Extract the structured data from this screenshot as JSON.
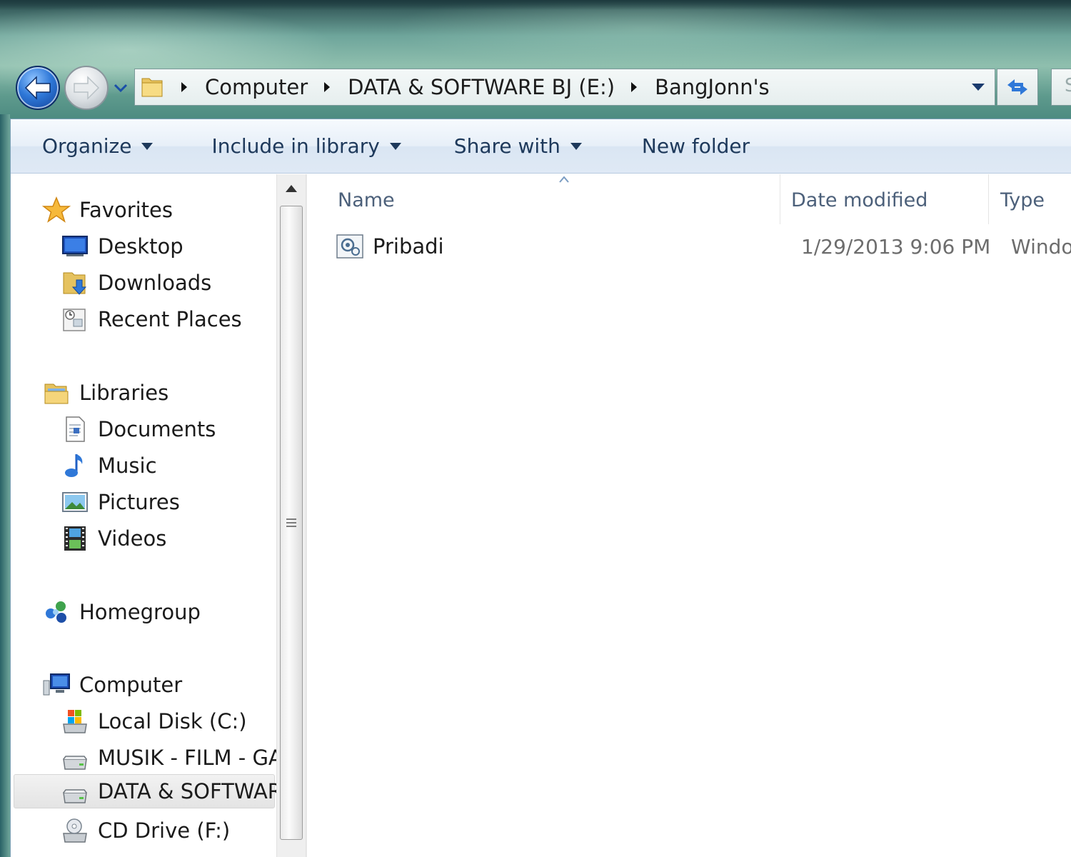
{
  "address_bar": {
    "crumbs": [
      "Computer",
      "DATA & SOFTWARE BJ (E:)",
      "BangJonn's"
    ]
  },
  "search": {
    "placeholder": "S"
  },
  "toolbar": {
    "organize": "Organize",
    "include_in_library": "Include in library",
    "share_with": "Share with",
    "new_folder": "New folder"
  },
  "nav": {
    "favorites": {
      "label": "Favorites",
      "items": [
        "Desktop",
        "Downloads",
        "Recent Places"
      ]
    },
    "libraries": {
      "label": "Libraries",
      "items": [
        "Documents",
        "Music",
        "Pictures",
        "Videos"
      ]
    },
    "homegroup": {
      "label": "Homegroup"
    },
    "computer": {
      "label": "Computer",
      "items": [
        "Local Disk (C:)",
        "MUSIK - FILM - GA",
        "DATA & SOFTWAR",
        "CD Drive (F:)"
      ]
    },
    "selected": "DATA & SOFTWAR"
  },
  "columns": {
    "name": "Name",
    "date_modified": "Date modified",
    "type": "Type"
  },
  "files": [
    {
      "name": "Pribadi",
      "date_modified": "1/29/2013 9:06 PM",
      "type": "Window",
      "icon": "system-file-icon"
    }
  ],
  "colors": {
    "toolbar_text": "#1e395b",
    "column_header_text": "#4c607a",
    "secondary_text": "#6d6d6d",
    "back_button": "#2f78d8"
  }
}
